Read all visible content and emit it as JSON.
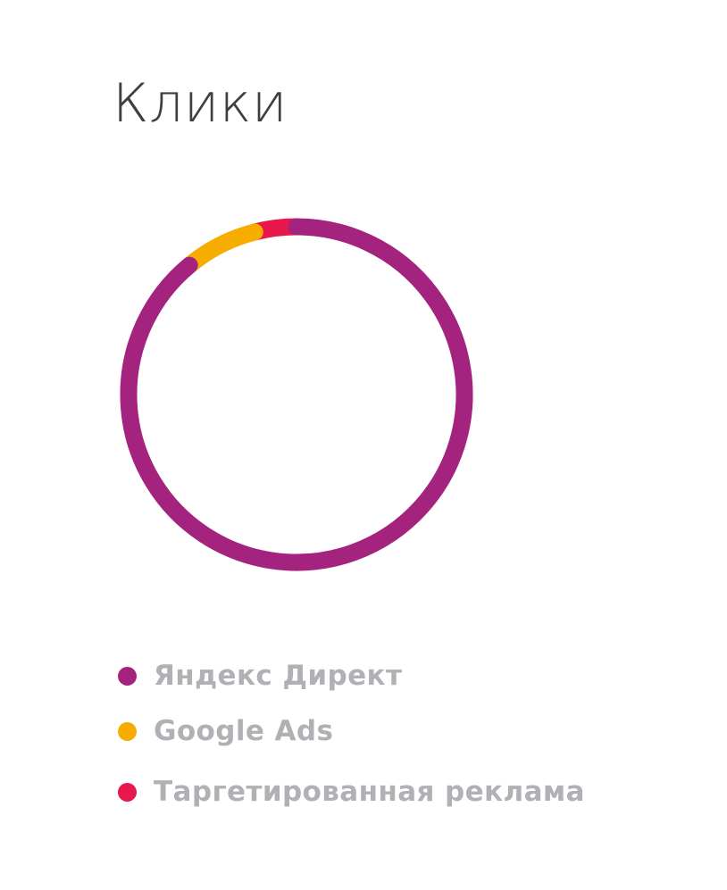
{
  "chart_data": {
    "type": "pie",
    "title": "Клики",
    "donut": true,
    "start_angle_deg": 0,
    "direction": "clockwise",
    "series": [
      {
        "name": "Яндекс Директ",
        "value": 89,
        "color": "#a4237f"
      },
      {
        "name": "Google Ads",
        "value": 7,
        "color": "#f6ad00"
      },
      {
        "name": "Таргетированная реклама",
        "value": 4,
        "color": "#e8174c"
      }
    ],
    "legend": "bottom"
  }
}
